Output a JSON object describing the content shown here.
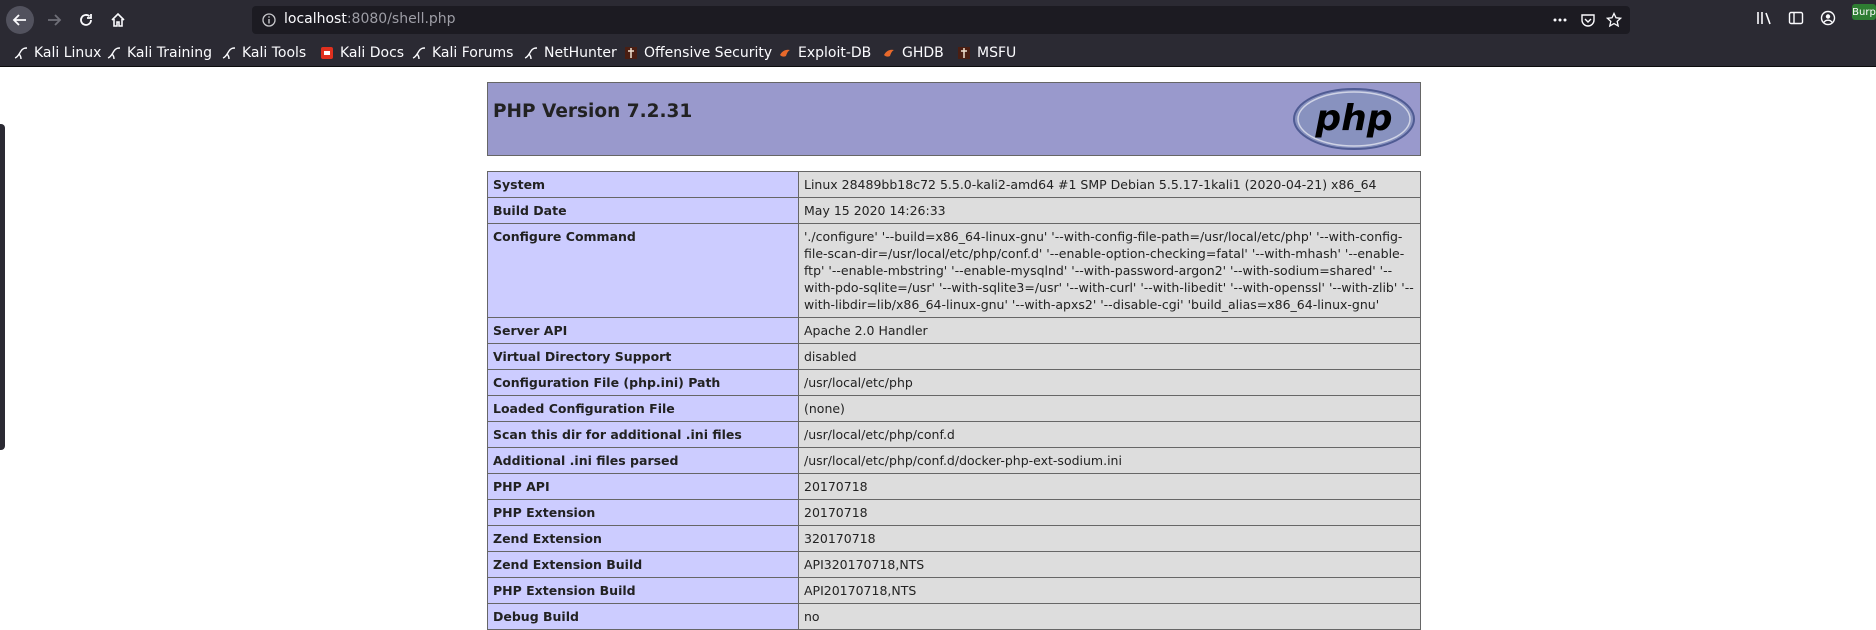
{
  "browser": {
    "url_host": "localhost",
    "url_rest": ":8080/shell.php",
    "burp_label": "Burp",
    "bookmarks": [
      {
        "label": "Kali Linux",
        "icon": "kali-dragon-icon"
      },
      {
        "label": "Kali Training",
        "icon": "kali-dragon-icon"
      },
      {
        "label": "Kali Tools",
        "icon": "kali-dragon-icon"
      },
      {
        "label": "Kali Docs",
        "icon": "kali-docs-icon"
      },
      {
        "label": "Kali Forums",
        "icon": "kali-dragon-icon"
      },
      {
        "label": "NetHunter",
        "icon": "kali-dragon-icon"
      },
      {
        "label": "Offensive Security",
        "icon": "offsec-icon"
      },
      {
        "label": "Exploit-DB",
        "icon": "exploit-db-icon"
      },
      {
        "label": "GHDB",
        "icon": "exploit-db-icon"
      },
      {
        "label": "MSFU",
        "icon": "offsec-icon"
      }
    ]
  },
  "phpinfo": {
    "title": "PHP Version 7.2.31",
    "logo_text": "php",
    "rows": [
      {
        "key": "System",
        "value": "Linux 28489bb18c72 5.5.0-kali2-amd64 #1 SMP Debian 5.5.17-1kali1 (2020-04-21) x86_64"
      },
      {
        "key": "Build Date",
        "value": "May 15 2020 14:26:33"
      },
      {
        "key": "Configure Command",
        "value": "'./configure' '--build=x86_64-linux-gnu' '--with-config-file-path=/usr/local/etc/php' '--with-config-file-scan-dir=/usr/local/etc/php/conf.d' '--enable-option-checking=fatal' '--with-mhash' '--enable-ftp' '--enable-mbstring' '--enable-mysqlnd' '--with-password-argon2' '--with-sodium=shared' '--with-pdo-sqlite=/usr' '--with-sqlite3=/usr' '--with-curl' '--with-libedit' '--with-openssl' '--with-zlib' '--with-libdir=lib/x86_64-linux-gnu' '--with-apxs2' '--disable-cgi' 'build_alias=x86_64-linux-gnu'"
      },
      {
        "key": "Server API",
        "value": "Apache 2.0 Handler"
      },
      {
        "key": "Virtual Directory Support",
        "value": "disabled"
      },
      {
        "key": "Configuration File (php.ini) Path",
        "value": "/usr/local/etc/php"
      },
      {
        "key": "Loaded Configuration File",
        "value": "(none)"
      },
      {
        "key": "Scan this dir for additional .ini files",
        "value": "/usr/local/etc/php/conf.d"
      },
      {
        "key": "Additional .ini files parsed",
        "value": "/usr/local/etc/php/conf.d/docker-php-ext-sodium.ini"
      },
      {
        "key": "PHP API",
        "value": "20170718"
      },
      {
        "key": "PHP Extension",
        "value": "20170718"
      },
      {
        "key": "Zend Extension",
        "value": "320170718"
      },
      {
        "key": "Zend Extension Build",
        "value": "API320170718,NTS"
      },
      {
        "key": "PHP Extension Build",
        "value": "API20170718,NTS"
      },
      {
        "key": "Debug Build",
        "value": "no"
      }
    ]
  },
  "colors": {
    "header_bg": "#9999cc",
    "key_bg": "#ccccff",
    "value_bg": "#dddddd",
    "chrome_bg": "#2b2a33"
  }
}
